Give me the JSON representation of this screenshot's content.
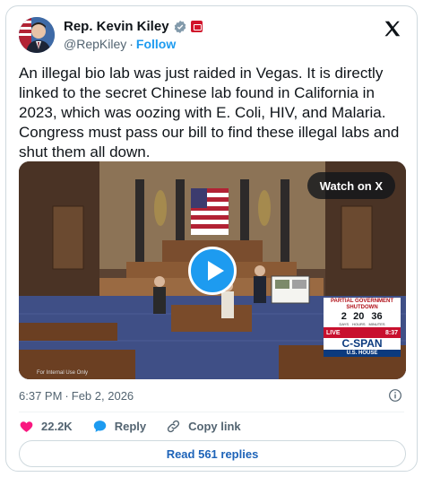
{
  "author": {
    "name": "Rep. Kevin Kiley",
    "handle": "@RepKiley",
    "separator": "·",
    "follow_label": "Follow"
  },
  "tweet": {
    "text": "An illegal bio lab was just raided in Vegas. It is directly linked to the secret Chinese lab found in California in 2023, which was oozing with E. Coli, HIV, and Malaria. Congress must pass our bill to find these illegal labs and shut them all down."
  },
  "media": {
    "watch_label": "Watch on X",
    "internal_label": "For Internal Use Only",
    "overlay": {
      "title": "PARTIAL GOVERNMENT SHUTDOWN",
      "days": "2",
      "hours": "20",
      "minutes": "36",
      "days_label": "DAYS",
      "hours_label": "HOURS",
      "minutes_label": "MINUTES",
      "live_label": "LIVE",
      "live_time": "8:37",
      "network": "C-SPAN",
      "channel": "U.S. HOUSE"
    }
  },
  "meta": {
    "time": "6:37 PM",
    "separator": "·",
    "date": "Feb 2, 2026"
  },
  "actions": {
    "likes": "22.2K",
    "reply_label": "Reply",
    "copy_label": "Copy link"
  },
  "replies_button": "Read 561 replies",
  "colors": {
    "accent": "#1d9bf0",
    "like": "#f91880",
    "cspan_red": "#c8102e",
    "cspan_blue": "#0b3a7e"
  },
  "icons": [
    "verified-badge-icon",
    "x-logo-icon",
    "play-icon",
    "info-icon",
    "heart-icon",
    "reply-icon",
    "link-icon"
  ]
}
